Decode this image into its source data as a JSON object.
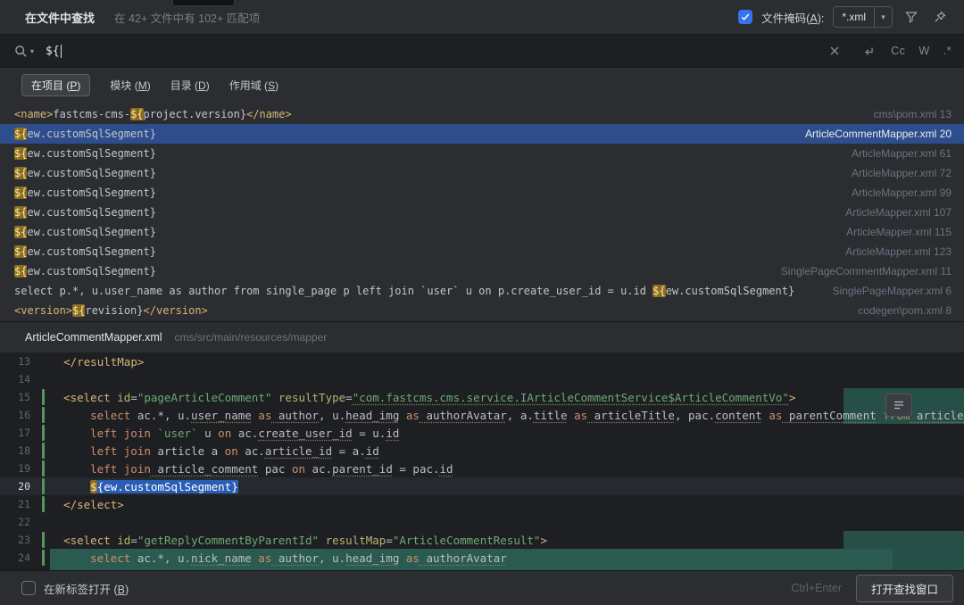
{
  "titlebar": {
    "title": "在文件中查找",
    "summary": "在 42+ 文件中有 102+ 匹配项",
    "mask_label": "文件掩码(A):",
    "mask_value": "*.xml"
  },
  "icons": {
    "chevron_down": "▾"
  },
  "search": {
    "query": "${",
    "toggle_case": "Cc",
    "toggle_words": "W",
    "toggle_regex": ".*"
  },
  "scopes": [
    {
      "label": "在项目 (P)",
      "selected": true
    },
    {
      "label": "模块 (M)",
      "selected": false
    },
    {
      "label": "目录 (D)",
      "selected": false
    },
    {
      "label": "作用域 (S)",
      "selected": false
    }
  ],
  "results": [
    {
      "selected": false,
      "file": "cms\\pom.xml 13",
      "segs": [
        {
          "t": "<name>",
          "c": "tag"
        },
        {
          "t": "fastcms-cms-",
          "c": "pl"
        },
        {
          "t": "${",
          "c": "match"
        },
        {
          "t": "project.version}",
          "c": "pl"
        },
        {
          "t": "</name>",
          "c": "tag"
        }
      ]
    },
    {
      "selected": true,
      "file": "ArticleCommentMapper.xml 20",
      "segs": [
        {
          "t": "${",
          "c": "match"
        },
        {
          "t": "ew.customSqlSegment}",
          "c": "pl"
        }
      ]
    },
    {
      "selected": false,
      "file": "ArticleMapper.xml 61",
      "segs": [
        {
          "t": "${",
          "c": "match"
        },
        {
          "t": "ew.customSqlSegment}",
          "c": "pl"
        }
      ]
    },
    {
      "selected": false,
      "file": "ArticleMapper.xml 72",
      "segs": [
        {
          "t": "${",
          "c": "match"
        },
        {
          "t": "ew.customSqlSegment}",
          "c": "pl"
        }
      ]
    },
    {
      "selected": false,
      "file": "ArticleMapper.xml 99",
      "segs": [
        {
          "t": "${",
          "c": "match"
        },
        {
          "t": "ew.customSqlSegment}",
          "c": "pl"
        }
      ]
    },
    {
      "selected": false,
      "file": "ArticleMapper.xml 107",
      "segs": [
        {
          "t": "${",
          "c": "match"
        },
        {
          "t": "ew.customSqlSegment}",
          "c": "pl"
        }
      ]
    },
    {
      "selected": false,
      "file": "ArticleMapper.xml 115",
      "segs": [
        {
          "t": "${",
          "c": "match"
        },
        {
          "t": "ew.customSqlSegment}",
          "c": "pl"
        }
      ]
    },
    {
      "selected": false,
      "file": "ArticleMapper.xml 123",
      "segs": [
        {
          "t": "${",
          "c": "match"
        },
        {
          "t": "ew.customSqlSegment}",
          "c": "pl"
        }
      ]
    },
    {
      "selected": false,
      "file": "SinglePageCommentMapper.xml 11",
      "segs": [
        {
          "t": "${",
          "c": "match"
        },
        {
          "t": "ew.customSqlSegment}",
          "c": "pl"
        }
      ]
    },
    {
      "selected": false,
      "file": "SinglePageMapper.xml 6",
      "segs": [
        {
          "t": "select p.*, u.user_name as author from single_page p left join `user` u on p.create_user_id = u.id ",
          "c": "pl"
        },
        {
          "t": "${",
          "c": "match"
        },
        {
          "t": "ew.customSqlSegment}",
          "c": "pl"
        }
      ]
    },
    {
      "selected": false,
      "file": "codegen\\pom.xml 8",
      "segs": [
        {
          "t": "<version>",
          "c": "tag"
        },
        {
          "t": "${",
          "c": "match"
        },
        {
          "t": "revision}",
          "c": "pl"
        },
        {
          "t": "</version>",
          "c": "tag"
        }
      ]
    }
  ],
  "preview": {
    "file": "ArticleCommentMapper.xml",
    "path": "cms/src/main/resources/mapper"
  },
  "editor": {
    "lines": [
      {
        "num": 13,
        "changed": false,
        "current": false,
        "segs": [
          {
            "t": "  ",
            "c": "pl"
          },
          {
            "t": "</resultMap>",
            "c": "tag"
          }
        ]
      },
      {
        "num": 14,
        "changed": false,
        "current": false,
        "segs": []
      },
      {
        "num": 15,
        "changed": true,
        "current": false,
        "segs": [
          {
            "t": "  ",
            "c": "pl"
          },
          {
            "t": "<select",
            "c": "tag"
          },
          {
            "t": " id",
            "c": "attr"
          },
          {
            "t": "=",
            "c": "pl"
          },
          {
            "t": "\"pageArticleComment\"",
            "c": "str"
          },
          {
            "t": " resultType",
            "c": "attr"
          },
          {
            "t": "=",
            "c": "pl"
          },
          {
            "t": "\"com.fastcms.cms.service.IArticleCommentService$ArticleCommentVo\"",
            "c": "str u"
          },
          {
            "t": ">",
            "c": "tag"
          }
        ]
      },
      {
        "num": 16,
        "changed": true,
        "current": false,
        "segs": [
          {
            "t": "      ",
            "c": "pl"
          },
          {
            "t": "select",
            "c": "kw"
          },
          {
            "t": " ac.*, u.",
            "c": "pl"
          },
          {
            "t": "user_name",
            "c": "pl u"
          },
          {
            "t": " as",
            "c": "kw"
          },
          {
            "t": " author",
            "c": "pl u"
          },
          {
            "t": ", u.",
            "c": "pl"
          },
          {
            "t": "head_img",
            "c": "pl u"
          },
          {
            "t": " as",
            "c": "kw"
          },
          {
            "t": " authorAvatar",
            "c": "pl u"
          },
          {
            "t": ", a.",
            "c": "pl"
          },
          {
            "t": "title",
            "c": "pl u"
          },
          {
            "t": " as",
            "c": "kw"
          },
          {
            "t": " articleTitle",
            "c": "pl u"
          },
          {
            "t": ", pac.",
            "c": "pl"
          },
          {
            "t": "content",
            "c": "pl u"
          },
          {
            "t": " as",
            "c": "kw"
          },
          {
            "t": " parentComment",
            "c": "pl u"
          },
          {
            "t": " from",
            "c": "kw"
          },
          {
            "t": " article_co",
            "c": "pl u"
          }
        ]
      },
      {
        "num": 17,
        "changed": true,
        "current": false,
        "segs": [
          {
            "t": "      ",
            "c": "pl"
          },
          {
            "t": "left join",
            "c": "kw"
          },
          {
            "t": " `user`",
            "c": "str"
          },
          {
            "t": " u",
            "c": "pl"
          },
          {
            "t": " on",
            "c": "kw"
          },
          {
            "t": " ac.",
            "c": "pl"
          },
          {
            "t": "create_user_id",
            "c": "pl u"
          },
          {
            "t": " = u.",
            "c": "pl"
          },
          {
            "t": "id",
            "c": "pl u"
          }
        ]
      },
      {
        "num": 18,
        "changed": true,
        "current": false,
        "segs": [
          {
            "t": "      ",
            "c": "pl"
          },
          {
            "t": "left join",
            "c": "kw"
          },
          {
            "t": " article a",
            "c": "pl"
          },
          {
            "t": " on",
            "c": "kw"
          },
          {
            "t": " ac.",
            "c": "pl"
          },
          {
            "t": "article_id",
            "c": "pl u"
          },
          {
            "t": " = a.",
            "c": "pl"
          },
          {
            "t": "id",
            "c": "pl u"
          }
        ]
      },
      {
        "num": 19,
        "changed": true,
        "current": false,
        "segs": [
          {
            "t": "      ",
            "c": "pl"
          },
          {
            "t": "left join",
            "c": "kw"
          },
          {
            "t": " article_comment",
            "c": "pl u"
          },
          {
            "t": " pac",
            "c": "pl"
          },
          {
            "t": " on",
            "c": "kw"
          },
          {
            "t": " ac.",
            "c": "pl"
          },
          {
            "t": "parent_id",
            "c": "pl u"
          },
          {
            "t": " = pac.",
            "c": "pl"
          },
          {
            "t": "id",
            "c": "pl u"
          }
        ]
      },
      {
        "num": 20,
        "changed": true,
        "current": true,
        "segs": [
          {
            "t": "      ",
            "c": "pl"
          },
          {
            "t": "$",
            "c": "match"
          },
          {
            "t": "{ew.customSqlSegment}",
            "c": "sel"
          }
        ]
      },
      {
        "num": 21,
        "changed": true,
        "current": false,
        "segs": [
          {
            "t": "  ",
            "c": "pl"
          },
          {
            "t": "</select>",
            "c": "tag"
          }
        ]
      },
      {
        "num": 22,
        "changed": false,
        "current": false,
        "segs": []
      },
      {
        "num": 23,
        "changed": true,
        "current": false,
        "segs": [
          {
            "t": "  ",
            "c": "pl"
          },
          {
            "t": "<select",
            "c": "tag"
          },
          {
            "t": " id",
            "c": "attr"
          },
          {
            "t": "=",
            "c": "pl"
          },
          {
            "t": "\"getReplyCommentByParentId\"",
            "c": "str"
          },
          {
            "t": " resultMap",
            "c": "attr"
          },
          {
            "t": "=",
            "c": "pl"
          },
          {
            "t": "\"ArticleCommentResult\"",
            "c": "str"
          },
          {
            "t": ">",
            "c": "tag"
          }
        ]
      },
      {
        "num": 24,
        "changed": true,
        "current": false,
        "segs": [
          {
            "t": "      ",
            "c": "pl"
          },
          {
            "t": "select",
            "c": "kw"
          },
          {
            "t": " ac.*, u.",
            "c": "pl"
          },
          {
            "t": "nick_name",
            "c": "pl u"
          },
          {
            "t": " as",
            "c": "kw"
          },
          {
            "t": " author",
            "c": "pl u"
          },
          {
            "t": ", u.",
            "c": "pl"
          },
          {
            "t": "head_img",
            "c": "pl u"
          },
          {
            "t": " as",
            "c": "kw"
          },
          {
            "t": " authorAvatar",
            "c": "pl u"
          }
        ]
      }
    ]
  },
  "footer": {
    "open_in_new_tab": "在新标签打开 (B)",
    "shortcut_hint": "Ctrl+Enter",
    "open_button": "打开查找窗口"
  },
  "colors": {
    "accent": "#3574f0",
    "selection_row": "#2e4d8c",
    "match_highlight": "#8a6d1f",
    "editor_selection": "#2a5db4",
    "vcs_added": "#57965c",
    "injected_fragment": "#254f47"
  }
}
